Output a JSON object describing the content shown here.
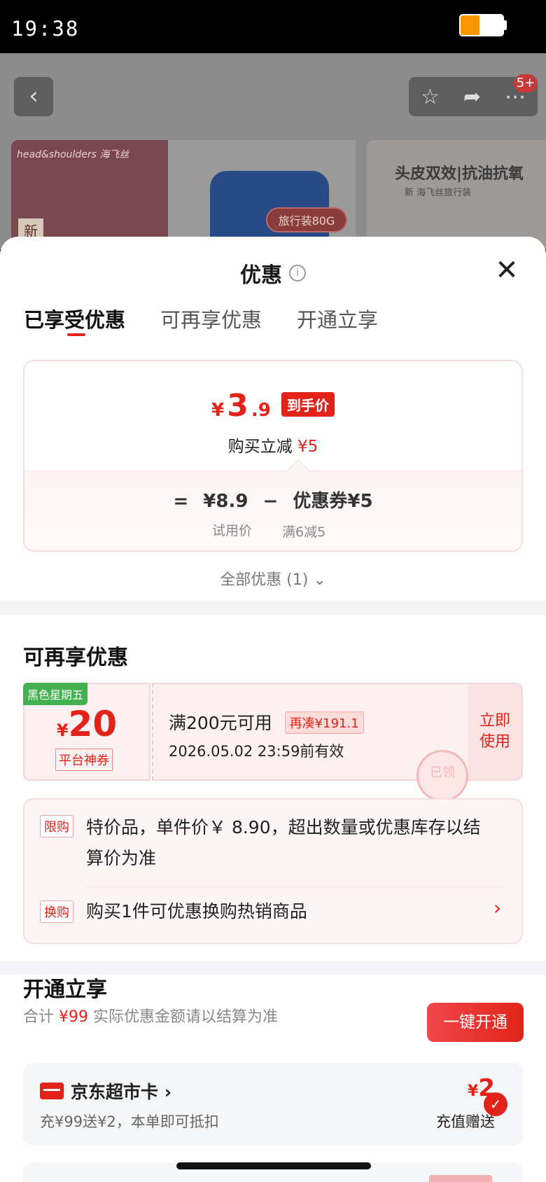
{
  "status_bar": {
    "time": "19:38",
    "battery_level": 0.45
  },
  "background_page": {
    "back_icon": "chevron-left-icon",
    "tool_icons": [
      "star-icon",
      "share-icon",
      "more-icon"
    ],
    "message_badge": "5+",
    "image1_logo": "head&shoulders 海飞丝",
    "image1_new": "新",
    "image2_tag": "旅行装80G",
    "image3_title": "头皮双效|抗油抗氧",
    "image3_sub": "新 海飞丝旅行装"
  },
  "sheet": {
    "title": "优惠",
    "tabs": [
      "已享受优惠",
      "可再享优惠",
      "开通立享"
    ],
    "active_tab": 0,
    "price": {
      "symbol": "¥",
      "integer": "3",
      "decimal": ".9",
      "tag": "到手价",
      "sub_prefix": "购买立减",
      "sub_value": "¥5",
      "formula_eq": "=",
      "formula_original": "¥8.9",
      "formula_minus": "−",
      "formula_coupon": "优惠券¥5",
      "label_original": "试用价",
      "label_coupon": "满6减5"
    },
    "all_offers": "全部优惠 (1)",
    "more_offers": {
      "title": "可再享优惠",
      "coupon": {
        "badge": "黑色星期五",
        "symbol": "¥",
        "amount": "20",
        "type": "平台神券",
        "condition": "满200元可用",
        "gap": "再凑¥191.1",
        "expire": "2026.05.02 23:59前有效",
        "stamp": "已领",
        "action": "立即使用"
      },
      "limit_tag": "限购",
      "limit_text": "特价品，单件价￥ 8.90，超出数量或优惠库存以结算价为准",
      "swap_tag": "换购",
      "swap_text": "购买1件可优惠换购热销商品"
    },
    "open_section": {
      "title": "开通立享",
      "sub_prefix": "合计",
      "sub_total": "¥99",
      "sub_suffix": "实际优惠金额请以结算为准",
      "button": "一键开通",
      "card": {
        "name": "京东超市卡 ›",
        "desc": "充¥99送¥2，本单即可抵扣",
        "symbol": "¥",
        "amount": "2",
        "label": "充值赠送",
        "checked": true
      }
    }
  }
}
